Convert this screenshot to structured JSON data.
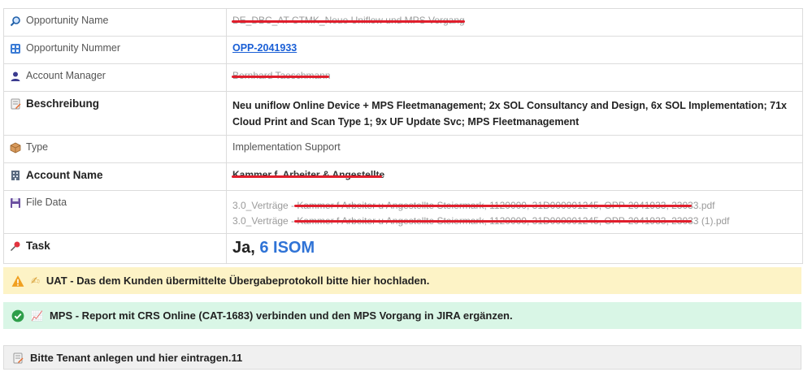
{
  "rows": [
    {
      "label": "Opportunity Name",
      "value": "DE_DBC_AT CTMK_Neue Uniflow und MPS Vorgang",
      "icon": "magnifier-icon"
    },
    {
      "label": "Opportunity Nummer",
      "value": "OPP-2041933",
      "icon": "id-card-icon"
    },
    {
      "label": "Account Manager",
      "value": "Bernhard Taeschmann",
      "icon": "person-icon"
    },
    {
      "label": "Beschreibung",
      "value": "Neu uniflow Online Device + MPS Fleetmanagement; 2x SOL Consultancy and Design, 6x SOL Implementation; 71x Cloud Print and Scan Type 1; 9x UF Update Svc; MPS Fleetmanagement",
      "icon": "memo-icon"
    },
    {
      "label": "Type",
      "value": "Implementation Support",
      "icon": "package-icon"
    },
    {
      "label": "Account Name",
      "value": "Kammer f. Arbeiter & Angestellte",
      "icon": "building-icon"
    },
    {
      "label": "File Data",
      "files": [
        "3.0_Verträge - Kammer f Arbeiter u Angestellte Steiermark, 1120000, 31D000001245, OPP-2041933, 23033.pdf",
        "3.0_Verträge - Kammer f Arbeiter u Angestellte Steiermark, 1120000, 31D000001245, OPP-2041933, 23033 (1).pdf"
      ],
      "icon": "floppy-disk-icon"
    },
    {
      "label": "Task",
      "value_prefix": "Ja, ",
      "value_accent": "6 ISOM",
      "icon": "pushpin-icon"
    }
  ],
  "banners": [
    {
      "icon": "warning-icon",
      "emoji": "✍",
      "text": "UAT - Das dem Kunden übermittelte Übergabeprotokoll bitte hier hochladen.",
      "bg": "#fdf3c6"
    },
    {
      "icon": "check-icon",
      "emoji": "📈",
      "text": "MPS - Report mit CRS Online (CAT-1683) verbinden und den MPS Vorgang in JIRA ergänzen.",
      "bg": "#d9f6e6"
    },
    {
      "icon": "memo-icon",
      "text": "Bitte Tenant anlegen und hier eintragen.11",
      "bg": "#f0f0f0"
    }
  ],
  "colors": {
    "redact": "#e01e2c",
    "link": "#1a5fd6",
    "accent": "#2f73d6"
  }
}
